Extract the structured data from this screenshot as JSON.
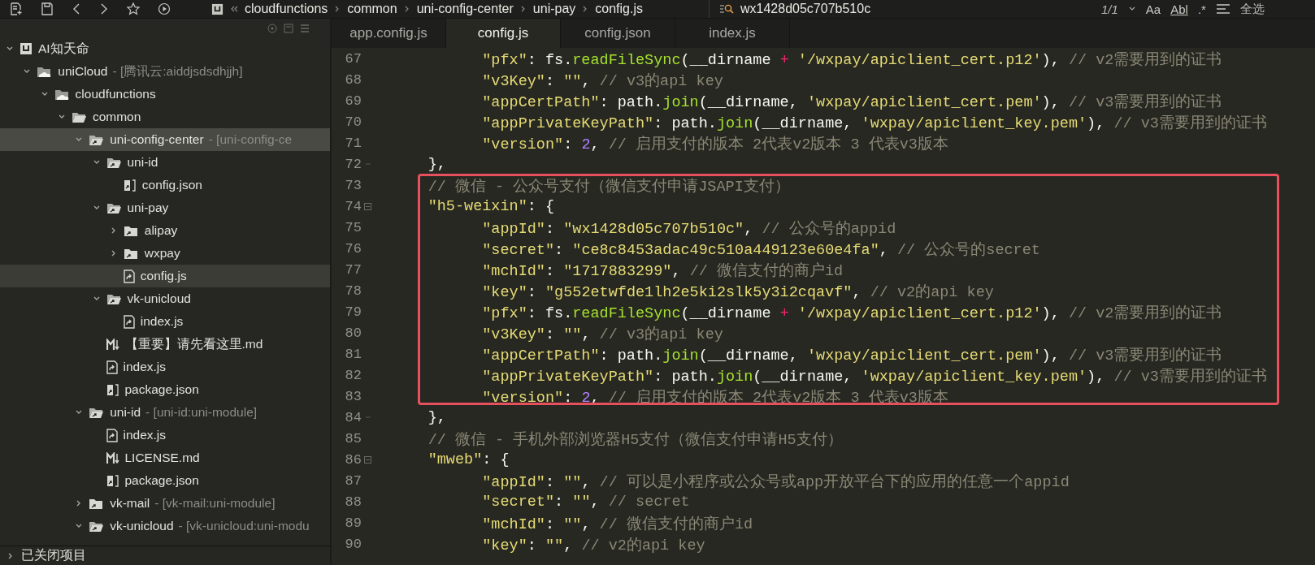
{
  "toolbar": {
    "breadcrumb": [
      "cloudfunctions",
      "common",
      "uni-config-center",
      "uni-pay",
      "config.js"
    ],
    "search": {
      "value": "wx1428d05c707b510c"
    },
    "match_count": "1/1",
    "options": [
      "Aa",
      "Abl",
      ".*"
    ],
    "select_all": "全选"
  },
  "sidebar": {
    "tree": [
      {
        "label": "AI知天命",
        "kind": "project",
        "expanded": true,
        "selected": false,
        "hovered": false,
        "children": [
          {
            "label": "uniCloud",
            "suffix": "- [腾讯云:aiddjsdsdhjjh]",
            "kind": "cloud-folder",
            "expanded": true,
            "selected": false,
            "hovered": false,
            "children": [
              {
                "label": "cloudfunctions",
                "kind": "cloud-folder",
                "expanded": true,
                "selected": false,
                "hovered": false,
                "children": [
                  {
                    "label": "common",
                    "kind": "folder",
                    "expanded": true,
                    "selected": false,
                    "hovered": false,
                    "children": [
                      {
                        "label": "uni-config-center",
                        "suffix": "- [uni-config-ce",
                        "kind": "module-folder",
                        "expanded": true,
                        "selected": false,
                        "hovered": true,
                        "children": [
                          {
                            "label": "uni-id",
                            "kind": "module-folder",
                            "expanded": true,
                            "selected": false,
                            "hovered": false,
                            "children": [
                              {
                                "label": "config.json",
                                "kind": "json",
                                "selected": false,
                                "hovered": false
                              }
                            ]
                          },
                          {
                            "label": "uni-pay",
                            "kind": "module-folder",
                            "expanded": true,
                            "selected": false,
                            "hovered": false,
                            "children": [
                              {
                                "label": "alipay",
                                "kind": "module-folder",
                                "expanded": false,
                                "selected": false,
                                "hovered": false
                              },
                              {
                                "label": "wxpay",
                                "kind": "module-folder",
                                "expanded": false,
                                "selected": false,
                                "hovered": false
                              },
                              {
                                "label": "config.js",
                                "kind": "js",
                                "selected": true,
                                "hovered": false
                              }
                            ]
                          },
                          {
                            "label": "vk-unicloud",
                            "kind": "module-folder",
                            "expanded": true,
                            "selected": false,
                            "hovered": false,
                            "children": [
                              {
                                "label": "index.js",
                                "kind": "js",
                                "selected": false,
                                "hovered": false
                              }
                            ]
                          },
                          {
                            "label": "【重要】请先看这里.md",
                            "kind": "md",
                            "selected": false,
                            "hovered": false
                          },
                          {
                            "label": "index.js",
                            "kind": "js",
                            "selected": false,
                            "hovered": false
                          },
                          {
                            "label": "package.json",
                            "kind": "json",
                            "selected": false,
                            "hovered": false
                          }
                        ]
                      },
                      {
                        "label": "uni-id",
                        "suffix": "- [uni-id:uni-module]",
                        "kind": "module-folder",
                        "expanded": true,
                        "selected": false,
                        "hovered": false,
                        "children": [
                          {
                            "label": "index.js",
                            "kind": "js",
                            "selected": false,
                            "hovered": false
                          },
                          {
                            "label": "LICENSE.md",
                            "kind": "md",
                            "selected": false,
                            "hovered": false
                          },
                          {
                            "label": "package.json",
                            "kind": "json",
                            "selected": false,
                            "hovered": false
                          }
                        ]
                      },
                      {
                        "label": "vk-mail",
                        "suffix": "- [vk-mail:uni-module]",
                        "kind": "module-folder",
                        "expanded": false,
                        "selected": false,
                        "hovered": false
                      },
                      {
                        "label": "vk-unicloud",
                        "suffix": "- [vk-unicloud:uni-modu",
                        "kind": "module-folder",
                        "expanded": true,
                        "selected": false,
                        "hovered": false
                      }
                    ]
                  }
                ]
              }
            ]
          }
        ]
      }
    ],
    "closed_projects": {
      "label": "已关闭项目",
      "expanded": false
    }
  },
  "editor": {
    "tabs": [
      {
        "label": "app.config.js",
        "selected": false
      },
      {
        "label": "config.js",
        "selected": true
      },
      {
        "label": "config.json",
        "selected": false
      },
      {
        "label": "index.js",
        "selected": false
      }
    ],
    "lines": [
      {
        "num": "67",
        "kind": "code",
        "tokens": [
          {
            "kind": "string",
            "text": "\t\t\"pfx\""
          },
          {
            "kind": "plain",
            "text": ": fs."
          },
          {
            "kind": "function",
            "text": "readFileSync"
          },
          {
            "kind": "plain",
            "text": "(__dirname "
          },
          {
            "kind": "operator",
            "text": "+"
          },
          {
            "kind": "string",
            "text": " '/wxpay/apiclient_cert.p12'"
          },
          {
            "kind": "plain",
            "text": "), "
          },
          {
            "kind": "comment",
            "text": "// v2需要用到的证书"
          }
        ]
      },
      {
        "num": "68",
        "kind": "code",
        "tokens": [
          {
            "kind": "string",
            "text": "\t\t\"v3Key\""
          },
          {
            "kind": "plain",
            "text": ": "
          },
          {
            "kind": "string",
            "text": "\"\""
          },
          {
            "kind": "plain",
            "text": ", "
          },
          {
            "kind": "comment",
            "text": "// v3的api key"
          }
        ]
      },
      {
        "num": "69",
        "kind": "code",
        "tokens": [
          {
            "kind": "string",
            "text": "\t\t\"appCertPath\""
          },
          {
            "kind": "plain",
            "text": ": path."
          },
          {
            "kind": "function",
            "text": "join"
          },
          {
            "kind": "plain",
            "text": "(__dirname, "
          },
          {
            "kind": "string",
            "text": "'wxpay/apiclient_cert.pem'"
          },
          {
            "kind": "plain",
            "text": "), "
          },
          {
            "kind": "comment",
            "text": "// v3需要用到的证书"
          }
        ]
      },
      {
        "num": "70",
        "kind": "code",
        "tokens": [
          {
            "kind": "string",
            "text": "\t\t\"appPrivateKeyPath\""
          },
          {
            "kind": "plain",
            "text": ": path."
          },
          {
            "kind": "function",
            "text": "join"
          },
          {
            "kind": "plain",
            "text": "(__dirname, "
          },
          {
            "kind": "string",
            "text": "'wxpay/apiclient_key.pem'"
          },
          {
            "kind": "plain",
            "text": "), "
          },
          {
            "kind": "comment",
            "text": "// v3需要用到的证书"
          }
        ]
      },
      {
        "num": "71",
        "kind": "code",
        "tokens": [
          {
            "kind": "string",
            "text": "\t\t\"version\""
          },
          {
            "kind": "plain",
            "text": ": "
          },
          {
            "kind": "number",
            "text": "2"
          },
          {
            "kind": "plain",
            "text": ", "
          },
          {
            "kind": "comment",
            "text": "// 启用支付的版本 2代表v2版本 3 代表v3版本"
          }
        ]
      },
      {
        "num": "72",
        "kind": "fold-end",
        "tokens": [
          {
            "kind": "plain",
            "text": "\t},"
          }
        ]
      },
      {
        "num": "73",
        "kind": "code",
        "tokens": [
          {
            "kind": "comment",
            "text": "\t// 微信 - 公众号支付（微信支付申请JSAPI支付）"
          }
        ]
      },
      {
        "num": "74",
        "kind": "fold-start",
        "tokens": [
          {
            "kind": "string",
            "text": "\t\"h5-weixin\""
          },
          {
            "kind": "plain",
            "text": ": {"
          }
        ]
      },
      {
        "num": "75",
        "kind": "code",
        "tokens": [
          {
            "kind": "string",
            "text": "\t\t\"appId\""
          },
          {
            "kind": "plain",
            "text": ": "
          },
          {
            "kind": "string",
            "text": "\"wx1428d05c707b510c\""
          },
          {
            "kind": "plain",
            "text": ", "
          },
          {
            "kind": "comment",
            "text": "// 公众号的appid"
          }
        ]
      },
      {
        "num": "76",
        "kind": "code",
        "tokens": [
          {
            "kind": "string",
            "text": "\t\t\"secret\""
          },
          {
            "kind": "plain",
            "text": ": "
          },
          {
            "kind": "string",
            "text": "\"ce8c8453adac49c510a449123e60e4fa\""
          },
          {
            "kind": "plain",
            "text": ", "
          },
          {
            "kind": "comment",
            "text": "// 公众号的secret"
          }
        ]
      },
      {
        "num": "77",
        "kind": "code",
        "tokens": [
          {
            "kind": "string",
            "text": "\t\t\"mchId\""
          },
          {
            "kind": "plain",
            "text": ": "
          },
          {
            "kind": "string",
            "text": "\"1717883299\""
          },
          {
            "kind": "plain",
            "text": ", "
          },
          {
            "kind": "comment",
            "text": "// 微信支付的商户id"
          }
        ]
      },
      {
        "num": "78",
        "kind": "code",
        "tokens": [
          {
            "kind": "string",
            "text": "\t\t\"key\""
          },
          {
            "kind": "plain",
            "text": ": "
          },
          {
            "kind": "string",
            "text": "\"g552etwfde1lh2e5ki2slk5y3i2cqavf\""
          },
          {
            "kind": "plain",
            "text": ", "
          },
          {
            "kind": "comment",
            "text": "// v2的api key"
          }
        ]
      },
      {
        "num": "79",
        "kind": "code",
        "tokens": [
          {
            "kind": "string",
            "text": "\t\t\"pfx\""
          },
          {
            "kind": "plain",
            "text": ": fs."
          },
          {
            "kind": "function",
            "text": "readFileSync"
          },
          {
            "kind": "plain",
            "text": "(__dirname "
          },
          {
            "kind": "operator",
            "text": "+"
          },
          {
            "kind": "string",
            "text": " '/wxpay/apiclient_cert.p12'"
          },
          {
            "kind": "plain",
            "text": "), "
          },
          {
            "kind": "comment",
            "text": "// v2需要用到的证书"
          }
        ]
      },
      {
        "num": "80",
        "kind": "code",
        "tokens": [
          {
            "kind": "string",
            "text": "\t\t\"v3Key\""
          },
          {
            "kind": "plain",
            "text": ": "
          },
          {
            "kind": "string",
            "text": "\"\""
          },
          {
            "kind": "plain",
            "text": ", "
          },
          {
            "kind": "comment",
            "text": "// v3的api key"
          }
        ]
      },
      {
        "num": "81",
        "kind": "code",
        "tokens": [
          {
            "kind": "string",
            "text": "\t\t\"appCertPath\""
          },
          {
            "kind": "plain",
            "text": ": path."
          },
          {
            "kind": "function",
            "text": "join"
          },
          {
            "kind": "plain",
            "text": "(__dirname, "
          },
          {
            "kind": "string",
            "text": "'wxpay/apiclient_cert.pem'"
          },
          {
            "kind": "plain",
            "text": "), "
          },
          {
            "kind": "comment",
            "text": "// v3需要用到的证书"
          }
        ]
      },
      {
        "num": "82",
        "kind": "code",
        "tokens": [
          {
            "kind": "string",
            "text": "\t\t\"appPrivateKeyPath\""
          },
          {
            "kind": "plain",
            "text": ": path."
          },
          {
            "kind": "function",
            "text": "join"
          },
          {
            "kind": "plain",
            "text": "(__dirname, "
          },
          {
            "kind": "string",
            "text": "'wxpay/apiclient_key.pem'"
          },
          {
            "kind": "plain",
            "text": "), "
          },
          {
            "kind": "comment",
            "text": "// v3需要用到的证书"
          }
        ]
      },
      {
        "num": "83",
        "kind": "code",
        "tokens": [
          {
            "kind": "string",
            "text": "\t\t\"version\""
          },
          {
            "kind": "plain",
            "text": ": "
          },
          {
            "kind": "number",
            "text": "2"
          },
          {
            "kind": "plain",
            "text": ", "
          },
          {
            "kind": "comment",
            "text": "// 启用支付的版本 2代表v2版本 3 代表v3版本"
          }
        ]
      },
      {
        "num": "84",
        "kind": "fold-end",
        "tokens": [
          {
            "kind": "plain",
            "text": "\t},"
          }
        ]
      },
      {
        "num": "85",
        "kind": "code",
        "tokens": [
          {
            "kind": "comment",
            "text": "\t// 微信 - 手机外部浏览器H5支付（微信支付申请H5支付）"
          }
        ]
      },
      {
        "num": "86",
        "kind": "fold-start",
        "tokens": [
          {
            "kind": "string",
            "text": "\t\"mweb\""
          },
          {
            "kind": "plain",
            "text": ": {"
          }
        ]
      },
      {
        "num": "87",
        "kind": "code",
        "tokens": [
          {
            "kind": "string",
            "text": "\t\t\"appId\""
          },
          {
            "kind": "plain",
            "text": ": "
          },
          {
            "kind": "string",
            "text": "\"\""
          },
          {
            "kind": "plain",
            "text": ", "
          },
          {
            "kind": "comment",
            "text": "// 可以是小程序或公众号或app开放平台下的应用的任意一个appid"
          }
        ]
      },
      {
        "num": "88",
        "kind": "code",
        "tokens": [
          {
            "kind": "string",
            "text": "\t\t\"secret\""
          },
          {
            "kind": "plain",
            "text": ": "
          },
          {
            "kind": "string",
            "text": "\"\""
          },
          {
            "kind": "plain",
            "text": ", "
          },
          {
            "kind": "comment",
            "text": "// secret"
          }
        ]
      },
      {
        "num": "89",
        "kind": "code",
        "tokens": [
          {
            "kind": "string",
            "text": "\t\t\"mchId\""
          },
          {
            "kind": "plain",
            "text": ": "
          },
          {
            "kind": "string",
            "text": "\"\""
          },
          {
            "kind": "plain",
            "text": ", "
          },
          {
            "kind": "comment",
            "text": "// 微信支付的商户id"
          }
        ]
      },
      {
        "num": "90",
        "kind": "code",
        "tokens": [
          {
            "kind": "string",
            "text": "\t\t\"key\""
          },
          {
            "kind": "plain",
            "text": ": "
          },
          {
            "kind": "string",
            "text": "\"\""
          },
          {
            "kind": "plain",
            "text": ", "
          },
          {
            "kind": "comment",
            "text": "// v2的api key"
          }
        ]
      }
    ]
  }
}
